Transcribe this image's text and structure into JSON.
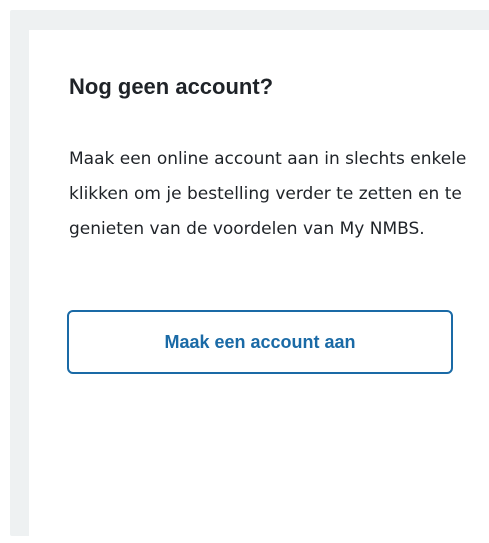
{
  "card": {
    "title": "Nog geen account?",
    "description": "Maak een online account aan in slechts enkele klikken om je bestelling verder te zetten en te genieten van de voordelen van My NMBS.",
    "button_label": "Maak een account aan"
  },
  "colors": {
    "panel_background": "#eef1f2",
    "card_background": "#ffffff",
    "text": "#1f2328",
    "accent": "#1a6aa6"
  }
}
